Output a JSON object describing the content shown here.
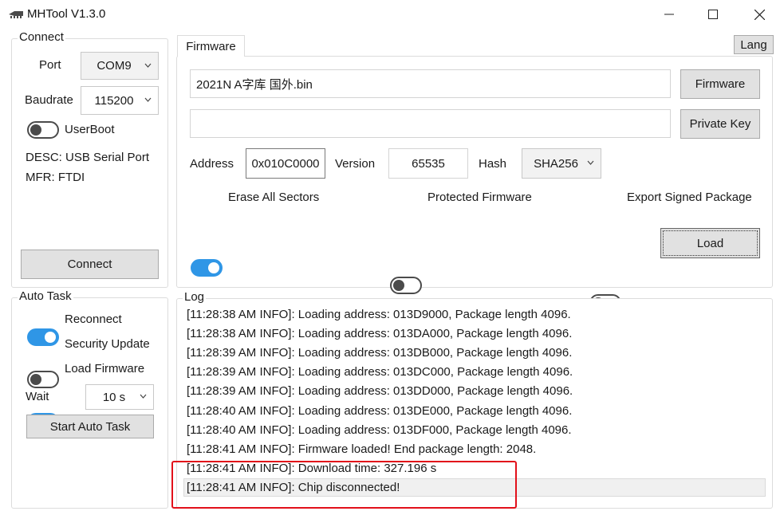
{
  "window": {
    "title": "MHTool V1.3.0"
  },
  "connect": {
    "group_title": "Connect",
    "port_label": "Port",
    "port_value": "COM9",
    "baudrate_label": "Baudrate",
    "baudrate_value": "115200",
    "userboot_label": "UserBoot",
    "userboot_on": false,
    "desc": "DESC: USB Serial Port",
    "mfr": "MFR: FTDI",
    "connect_button": "Connect"
  },
  "auto_task": {
    "group_title": "Auto Task",
    "reconnect_label": "Reconnect",
    "reconnect_on": true,
    "security_update_label": "Security Update",
    "security_update_on": false,
    "load_firmware_label": "Load Firmware",
    "load_firmware_on": true,
    "wait_label": "Wait",
    "wait_value": "10 s",
    "start_button": "Start Auto Task"
  },
  "firmware": {
    "tab_label": "Firmware",
    "lang_button": "Lang",
    "file_path": "2021N A字库 国外.bin",
    "firmware_button": "Firmware",
    "private_key_value": "",
    "private_key_button": "Private Key",
    "address_label": "Address",
    "address_value": "0x010C0000",
    "version_label": "Version",
    "version_value": "65535",
    "hash_label": "Hash",
    "hash_value": "SHA256",
    "erase_all_label": "Erase All Sectors",
    "erase_all_on": true,
    "protected_label": "Protected Firmware",
    "protected_on": false,
    "export_label": "Export Signed Package",
    "export_on": false,
    "load_button": "Load"
  },
  "log": {
    "group_title": "Log",
    "lines": [
      "[11:28:38 AM INFO]: Loading address: 013D9000, Package length 4096.",
      "[11:28:38 AM INFO]: Loading address: 013DA000, Package length 4096.",
      "[11:28:39 AM INFO]: Loading address: 013DB000, Package length 4096.",
      "[11:28:39 AM INFO]: Loading address: 013DC000, Package length 4096.",
      "[11:28:39 AM INFO]: Loading address: 013DD000, Package length 4096.",
      "[11:28:40 AM INFO]: Loading address: 013DE000, Package length 4096.",
      "[11:28:40 AM INFO]: Loading address: 013DF000, Package length 4096.",
      "[11:28:41 AM INFO]: Firmware loaded! End package length: 2048.",
      "[11:28:41 AM INFO]: Download time: 327.196 s",
      "[11:28:41 AM INFO]: Chip disconnected!"
    ],
    "highlight_color": "#e2101a"
  },
  "colors": {
    "toggle_on": "#2f96e6",
    "toggle_off": "#4b4b4b"
  }
}
